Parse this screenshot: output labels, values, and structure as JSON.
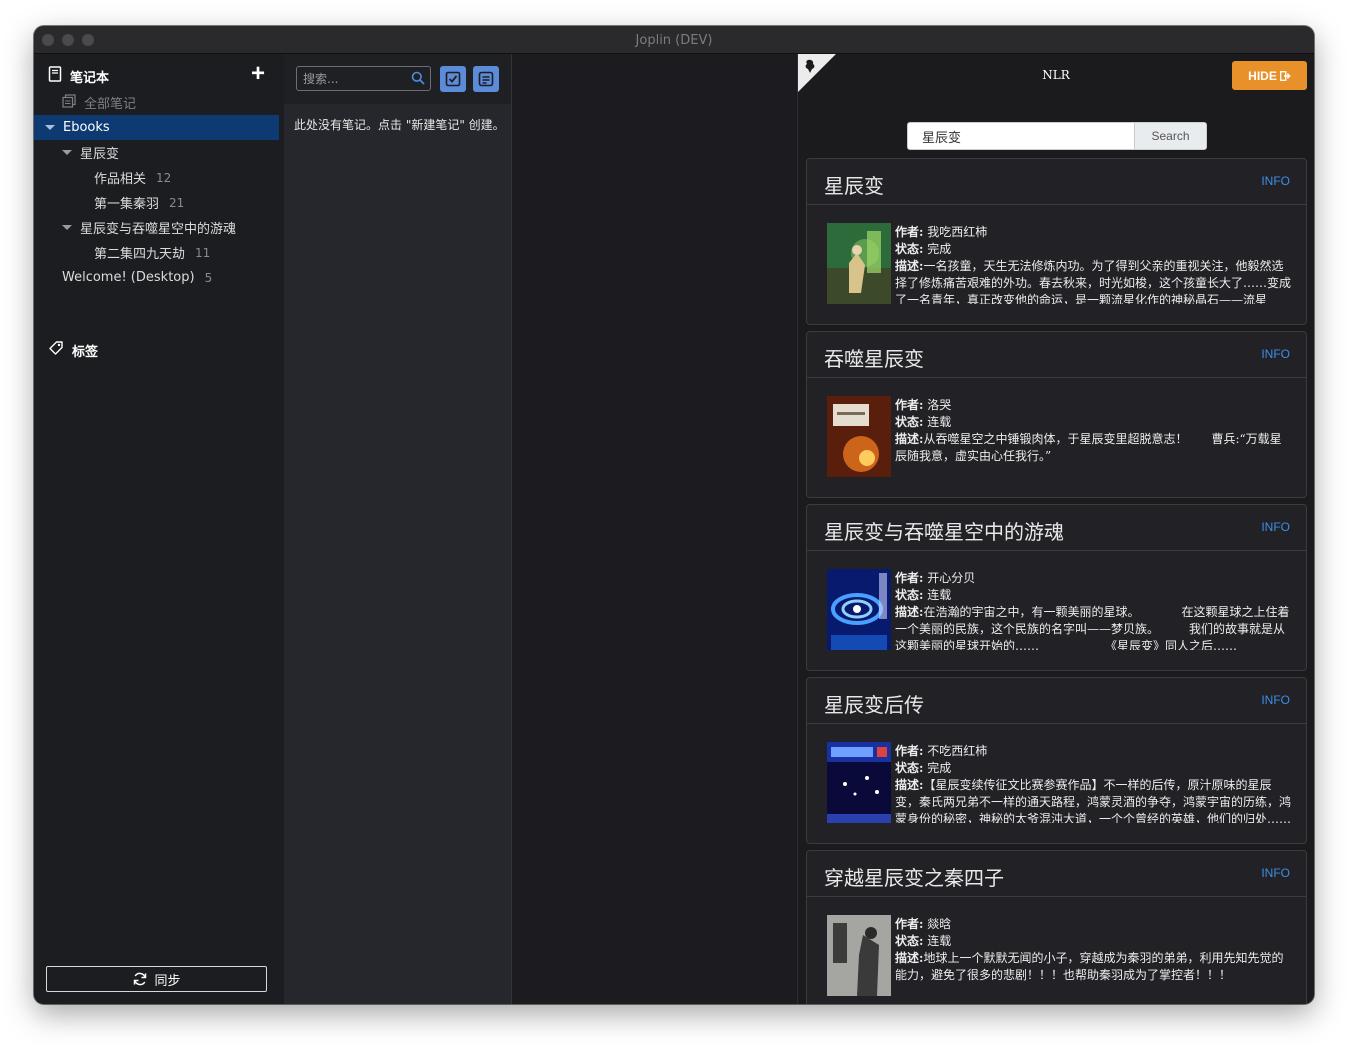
{
  "window": {
    "title": "Joplin (DEV)"
  },
  "sidebar": {
    "notebooks_label": "笔记本",
    "all_notes_label": "全部笔记",
    "items": [
      {
        "label": "Ebooks",
        "count": ""
      },
      {
        "label": "星辰变",
        "count": ""
      },
      {
        "label": "作品相关",
        "count": "12"
      },
      {
        "label": "第一集秦羽",
        "count": "21"
      },
      {
        "label": "星辰变与吞噬星空中的游魂",
        "count": ""
      },
      {
        "label": "第二集四九天劫",
        "count": "11"
      },
      {
        "label": "Welcome! (Desktop)",
        "count": "5"
      }
    ],
    "tags_label": "标签",
    "sync_label": "同步"
  },
  "notelist": {
    "search_placeholder": "搜索...",
    "empty_message": "此处没有笔记。点击 \"新建笔记\" 创建。"
  },
  "panel": {
    "brand": "NLR",
    "hide_label": "HIDE",
    "search_value": "星辰变",
    "search_button": "Search",
    "info_label": "INFO",
    "author_key": "作者:",
    "status_key": "状态:",
    "desc_key": "描述:",
    "books": [
      {
        "title": "星辰变",
        "author": "我吃西红柿",
        "status": "完成",
        "desc": "一名孩童，天生无法修炼内功。为了得到父亲的重视关注，他毅然选择了修炼痛苦艰难的外功。春去秋来，时光如梭，这个孩童长大了……变成了一名青年，真正改变他的命运，是一颗流星化作的神秘晶石——流星泪……"
      },
      {
        "title": "吞噬星辰变",
        "author": "洛哭",
        "status": "连载",
        "desc": "从吞噬星空之中锤锻肉体，于星辰变里超脱意志！　　曹兵:“万载星辰随我意，虚实由心任我行。”"
      },
      {
        "title": "星辰变与吞噬星空中的游魂",
        "author": "开心分贝",
        "status": "连载",
        "desc": "在浩瀚的宇宙之中，有一颗美丽的星球。　　　　在这颗星球之上住着一个美丽的民族，这个民族的名字叫——梦贝族。　　　我们的故事就是从这颗美丽的星球开始的……　　　　　　《星辰变》同人之后……"
      },
      {
        "title": "星辰变后传",
        "author": "不吃西红柿",
        "status": "完成",
        "desc": "【星辰变续传征文比赛参赛作品】不一样的后传，原汁原味的星辰变，秦氏两兄弟不一样的通天路程，鸿蒙灵酒的争夺，鸿蒙宇宙的历练，鸿蒙身份的秘密，神秘的太爷混沌大道，一个个曾经的英雄，他们的归处……"
      },
      {
        "title": "穿越星辰变之秦四子",
        "author": "燚晗",
        "status": "连载",
        "desc": "地球上一个默默无闻的小子，穿越成为秦羽的弟弟，利用先知先觉的能力，避免了很多的悲剧！！！也帮助秦羽成为了掌控者！！！"
      }
    ]
  },
  "colors": {
    "accent": "#e8912a",
    "selection": "#0d3a73",
    "link": "#3d8ee8",
    "toolbar_button": "#5b8bd9"
  }
}
